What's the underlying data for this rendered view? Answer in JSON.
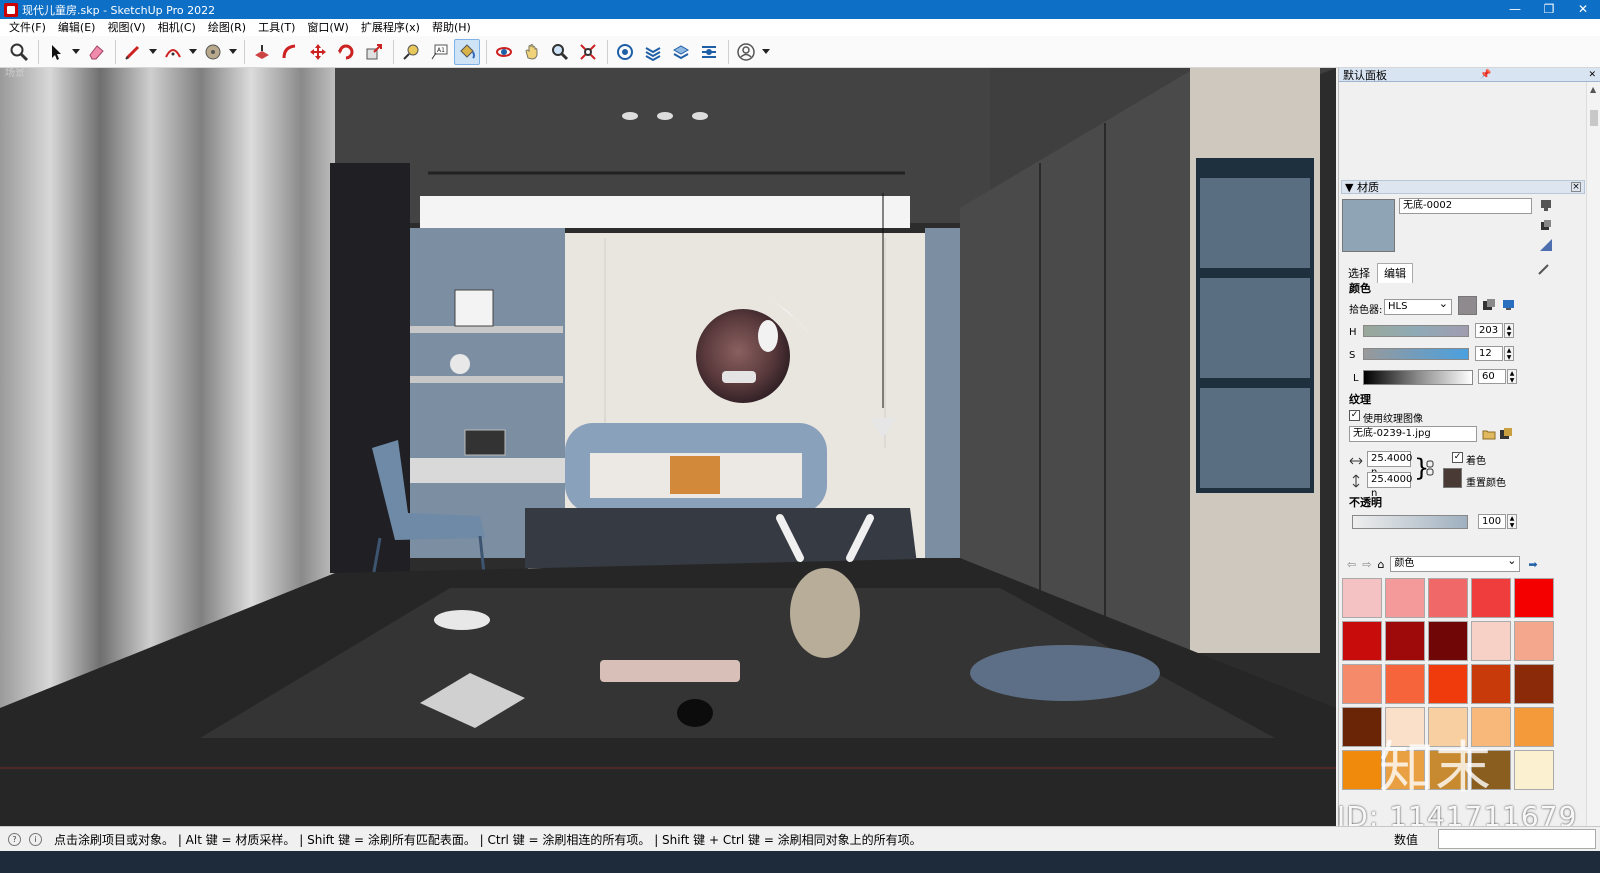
{
  "window": {
    "title": "现代儿童房.skp - SketchUp Pro 2022",
    "controls": [
      "—",
      "❐",
      "✕"
    ]
  },
  "menu": [
    "文件(F)",
    "编辑(E)",
    "视图(V)",
    "相机(C)",
    "绘图(R)",
    "工具(T)",
    "窗口(W)",
    "扩展程序(x)",
    "帮助(H)"
  ],
  "toolbar": {
    "tools": [
      "zoom",
      "select",
      "eraser",
      "pencil",
      "arc",
      "shape",
      "push-pull",
      "follow-me",
      "move",
      "rotate",
      "scale",
      "tape",
      "text",
      "paint-bucket",
      "orbit",
      "pan",
      "zoom-tool",
      "zoom-extents",
      "warehouse",
      "extension-warehouse",
      "layer-out",
      "style",
      "account"
    ],
    "active_tool": "paint-bucket"
  },
  "viewport": {
    "scene_label": "场景"
  },
  "panel": {
    "title": "默认面板",
    "materials": {
      "tray_title": "材质",
      "material_name": "无底-0002",
      "swatch_color": "#8fa4b4",
      "tabs": [
        "选择",
        "编辑"
      ],
      "active_tab": "编辑",
      "color_section": "颜色",
      "picker_label": "拾色器:",
      "picker_value": "HLS",
      "h_label": "H",
      "h_value": "203",
      "s_label": "S",
      "s_value": "12",
      "l_label": "L",
      "l_value": "60",
      "texture_section": "纹理",
      "use_texture_label": "使用纹理图像",
      "use_texture_checked": true,
      "texture_file": "无底-0239-1.jpg",
      "width_value": "25.4000 n",
      "height_value": "25.4000 n",
      "colorize_label": "着色",
      "colorize_checked": true,
      "reset_color_label": "重置颜色",
      "opacity_section": "不透明",
      "opacity_value": "100",
      "collection_value": "颜色",
      "palette": [
        "#f4c2c2",
        "#f59a9a",
        "#f06868",
        "#ef3c3c",
        "#f50000",
        "#c80c0c",
        "#9e0909",
        "#700606",
        "#f7d0c6",
        "#f5a78e",
        "#f58a6a",
        "#f5643a",
        "#f03c0c",
        "#c83a0a",
        "#8a2a08",
        "#6a2406",
        "#fae0c8",
        "#f7cfa0",
        "#f7b87a",
        "#f59a3a",
        "#f08a0c",
        "#e9a042",
        "#c88a30",
        "#8a5e1e",
        "#fbf0d0"
      ]
    }
  },
  "status": {
    "message": "点击涂刷项目或对象。 | Alt 键 = 材质采样。 | Shift 键 = 涂刷所有匹配表面。 | Ctrl 键 = 涂刷相连的所有项。 | Shift 键 + Ctrl 键 = 涂刷相同对象上的所有项。",
    "measure_label": "数值"
  },
  "watermark": {
    "logo_text": "知末",
    "id_text": "ID: 1141711679"
  }
}
